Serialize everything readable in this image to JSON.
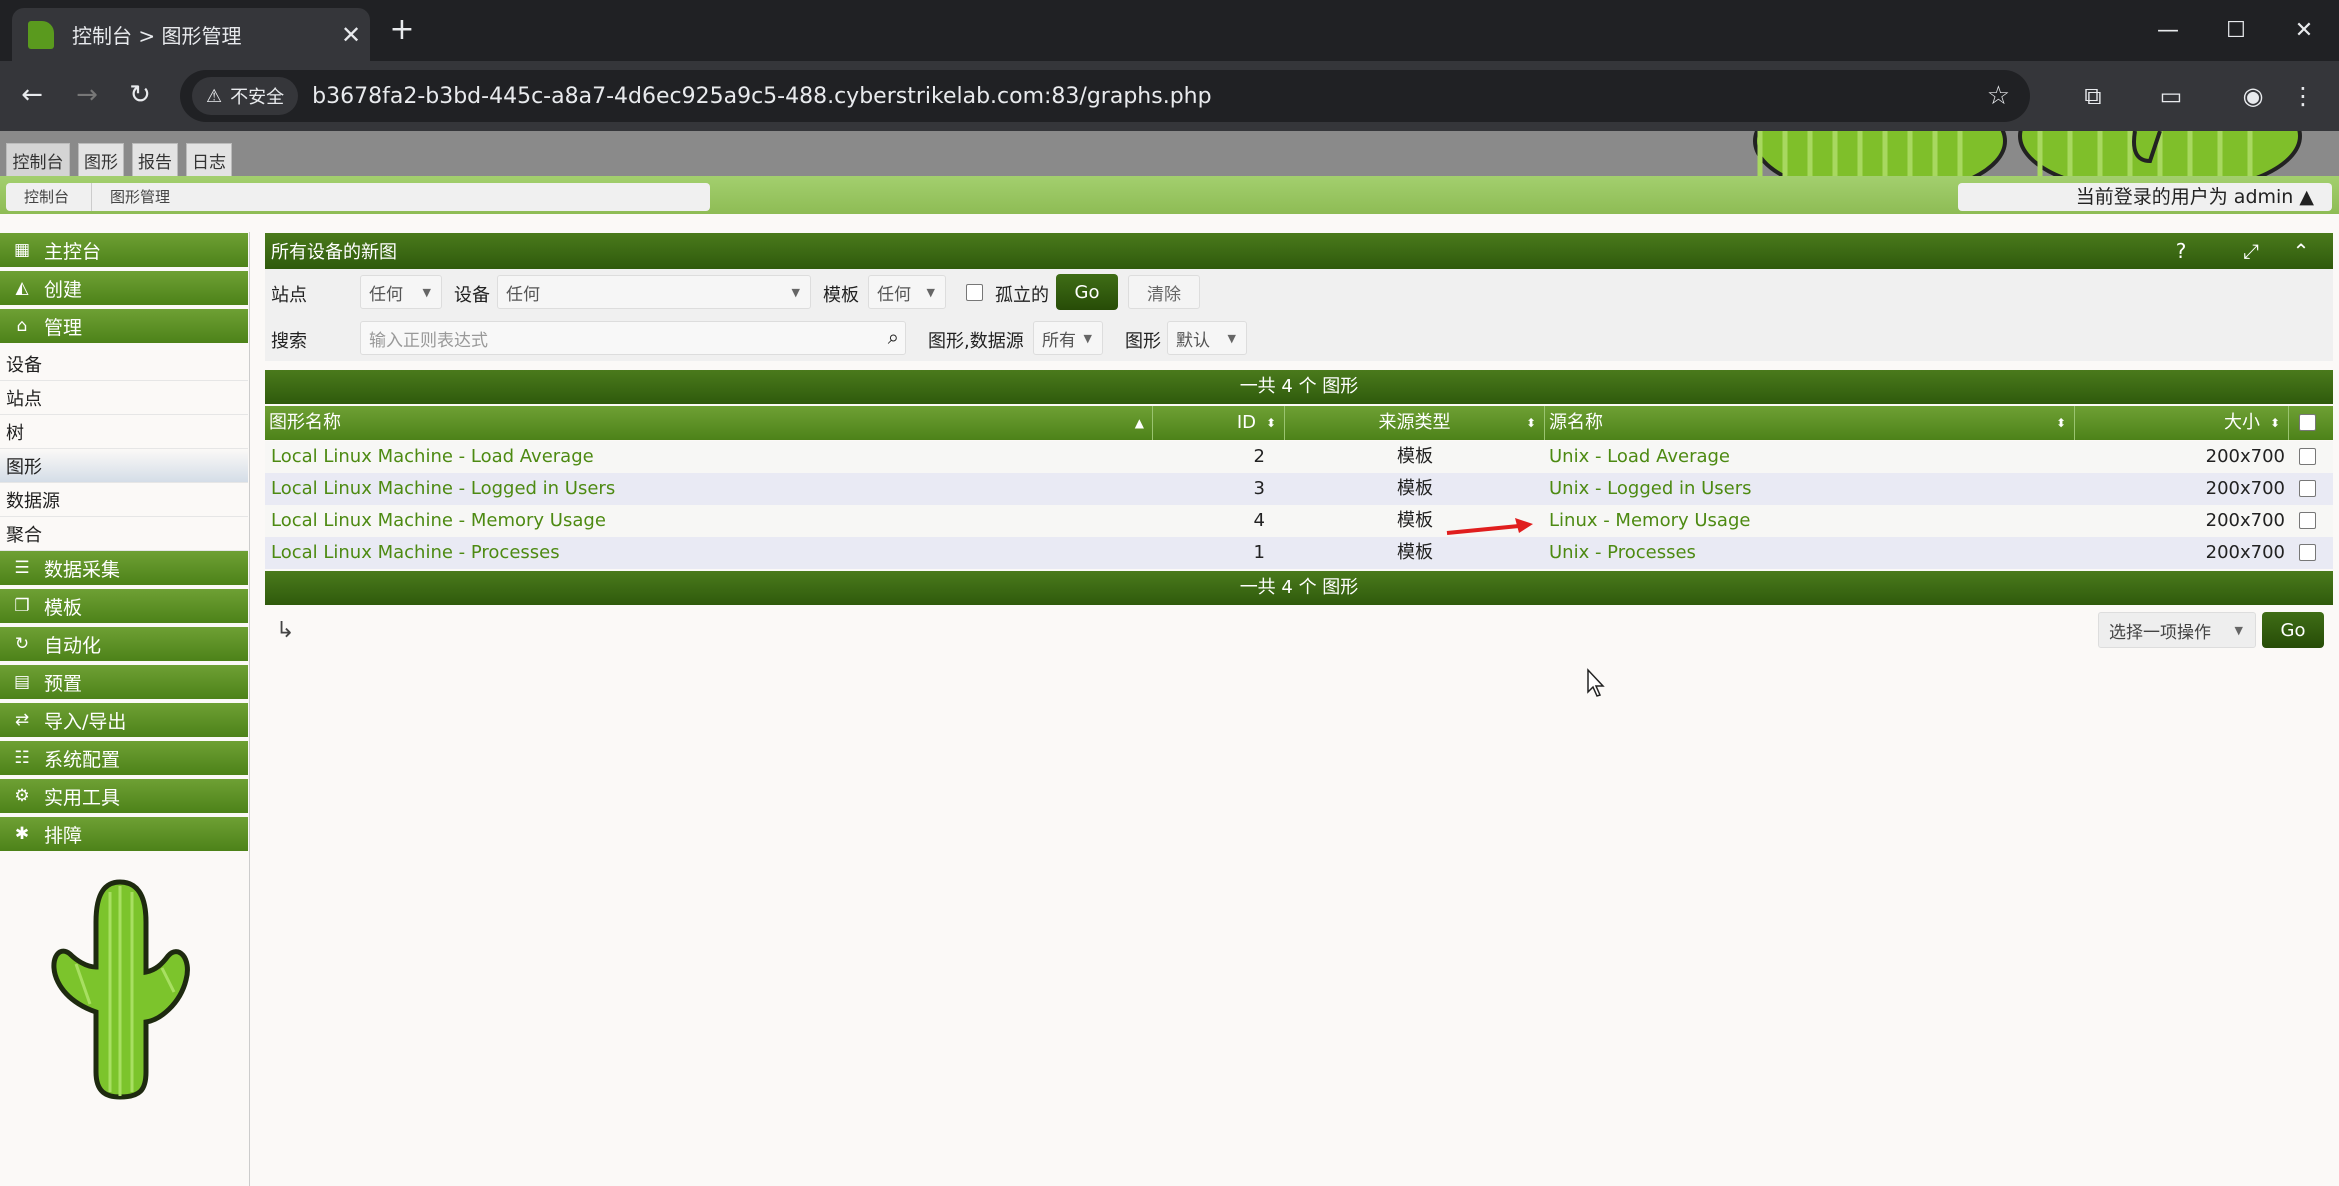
{
  "browser": {
    "tab_title": "控制台 > 图形管理",
    "new_tab": "+",
    "insecure_label": "不安全",
    "url": "b3678fa2-b3bd-445c-a8a7-4d6ec925a9c5-488.cyberstrikelab.com:83/graphs.php"
  },
  "cacti": {
    "main_tabs": [
      "控制台",
      "图形",
      "报告",
      "日志"
    ],
    "breadcrumb": [
      "控制台",
      "图形管理"
    ],
    "user_label": "当前登录的用户为 admin ▲",
    "sidebar": {
      "console": "主控台",
      "create": "创建",
      "manage": "管理",
      "manage_items": [
        "设备",
        "站点",
        "树",
        "图形",
        "数据源",
        "聚合"
      ],
      "groups": [
        "数据采集",
        "模板",
        "自动化",
        "预置",
        "导入/导出",
        "系统配置",
        "实用工具",
        "排障"
      ]
    },
    "panel_title": "所有设备的新图",
    "filter": {
      "site_label": "站点",
      "site_value": "任何",
      "device_label": "设备",
      "device_value": "任何",
      "template_label": "模板",
      "template_value": "任何",
      "orphan_label": "孤立的",
      "go": "Go",
      "clear": "清除",
      "search_label": "搜索",
      "search_placeholder": "输入正则表达式",
      "graph_ds_label": "图形,数据源",
      "graph_ds_value": "所有",
      "graph_label": "图形",
      "graph_value": "默认"
    },
    "count_text": "一共 4 个 图形",
    "columns": [
      "图形名称",
      "ID",
      "来源类型",
      "源名称",
      "大小"
    ],
    "rows": [
      {
        "name": "Local Linux Machine - Load Average",
        "id": "2",
        "type": "模板",
        "source": "Unix - Load Average",
        "size": "200x700"
      },
      {
        "name": "Local Linux Machine - Logged in Users",
        "id": "3",
        "type": "模板",
        "source": "Unix - Logged in Users",
        "size": "200x700"
      },
      {
        "name": "Local Linux Machine - Memory Usage",
        "id": "4",
        "type": "模板",
        "source": "Linux - Memory Usage",
        "size": "200x700"
      },
      {
        "name": "Local Linux Machine - Processes",
        "id": "1",
        "type": "模板",
        "source": "Unix - Processes",
        "size": "200x700"
      }
    ],
    "action_select": "选择一项操作",
    "action_go": "Go"
  },
  "colors": {
    "green_dark": "#2f5a0c",
    "green_mid": "#4d8219",
    "link": "#4d8a12",
    "arrow": "#e01e1e"
  }
}
